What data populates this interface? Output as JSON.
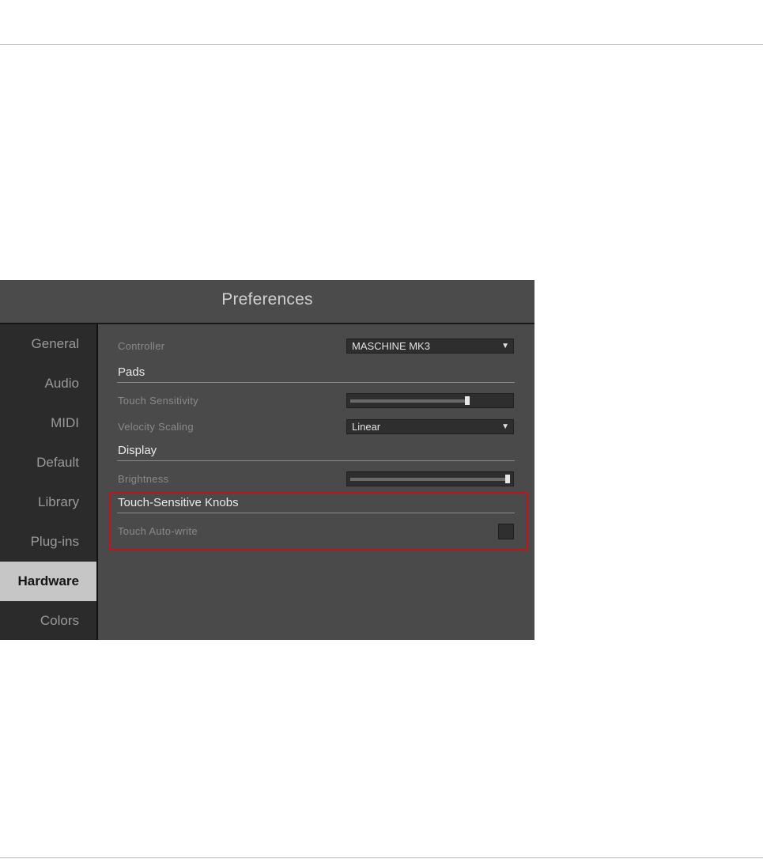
{
  "window": {
    "title": "Preferences"
  },
  "sidebar": {
    "items": [
      {
        "label": "General",
        "active": false
      },
      {
        "label": "Audio",
        "active": false
      },
      {
        "label": "MIDI",
        "active": false
      },
      {
        "label": "Default",
        "active": false
      },
      {
        "label": "Library",
        "active": false
      },
      {
        "label": "Plug-ins",
        "active": false
      },
      {
        "label": "Hardware",
        "active": true
      },
      {
        "label": "Colors",
        "active": false
      }
    ]
  },
  "content": {
    "controller": {
      "label": "Controller",
      "value": "MASCHINE MK3"
    },
    "pads": {
      "heading": "Pads",
      "touch_sensitivity": {
        "label": "Touch Sensitivity",
        "level": 0.74
      },
      "velocity_scaling": {
        "label": "Velocity Scaling",
        "value": "Linear"
      }
    },
    "display": {
      "heading": "Display",
      "brightness": {
        "label": "Brightness",
        "level": 1.0
      }
    },
    "touch_sensitive_knobs": {
      "heading": "Touch-Sensitive Knobs",
      "touch_auto_write": {
        "label": "Touch Auto-write",
        "checked": false
      }
    }
  },
  "colors": {
    "highlight_border": "#c0141c",
    "active_tab_bg": "#c6c6c6",
    "panel_bg": "#4a4a4a",
    "sidebar_bg": "#2b2b2b"
  },
  "icons": {
    "dropdown_arrow": "triangle-down-icon"
  },
  "glyphs": {
    "dropdown_arrow": "▼"
  }
}
